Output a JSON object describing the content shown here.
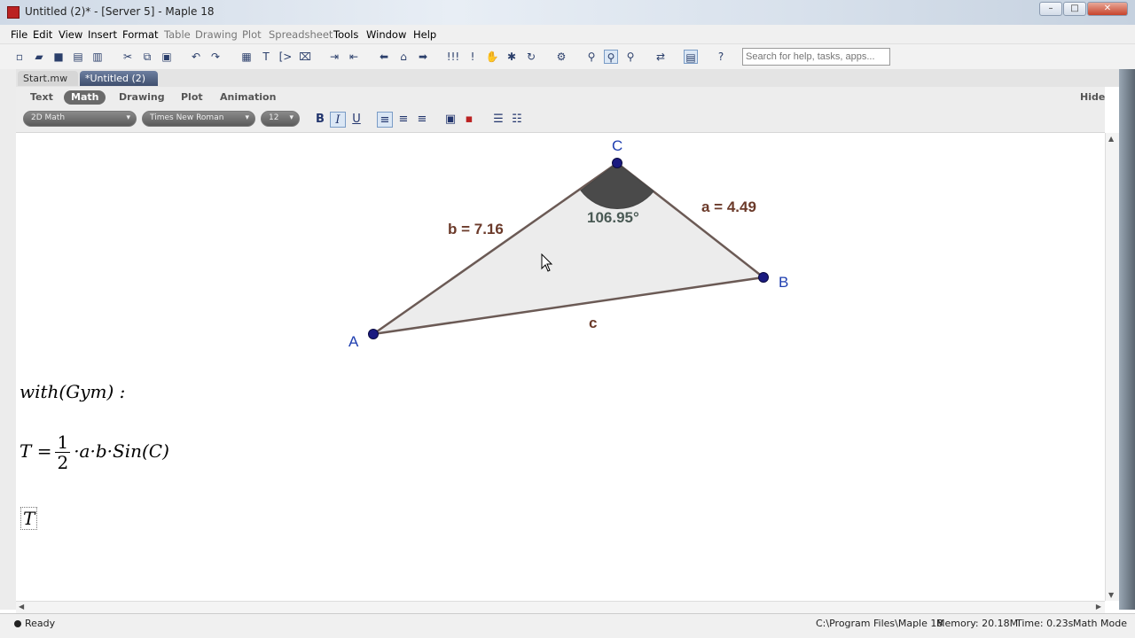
{
  "window": {
    "title": "Untitled (2)* - [Server 5] - Maple 18",
    "controls": [
      "–",
      "□",
      "✕"
    ]
  },
  "menu": [
    "File",
    "Edit",
    "View",
    "Insert",
    "Format",
    "Table",
    "Drawing",
    "Plot",
    "Spreadsheet",
    "Tools",
    "Window",
    "Help"
  ],
  "search": {
    "placeholder": "Search for help, tasks, apps..."
  },
  "doc_tabs": [
    {
      "label": "Start.mw"
    },
    {
      "label": "*Untitled (2)",
      "close": "✕"
    }
  ],
  "context_bar": {
    "tabs": [
      "Text",
      "Math",
      "Drawing",
      "Plot",
      "Animation"
    ],
    "selected_tab": "Math",
    "hide_label": "Hide",
    "style_select": "2D Math",
    "font_select": "Times New Roman",
    "size_select": "12",
    "bold_label": "B",
    "italic_label": "I",
    "underline_label": "U"
  },
  "geometry": {
    "points": [
      {
        "label": "A",
        "color": "#1f3fb0"
      },
      {
        "label": "B",
        "color": "#1f3fb0"
      },
      {
        "label": "C",
        "color": "#1f3fb0"
      }
    ],
    "side_labels": {
      "a": "a = 4.49",
      "b": "b = 7.16",
      "c": "c"
    },
    "angle_label": "106.95°",
    "label_color": "#6b3a2a",
    "triangle_fill": "#ececec",
    "angle_fill": "#4a4a4a"
  },
  "math": {
    "line1": "with(Gym) :",
    "line2_lhs": "T =",
    "line2_num": "1",
    "line2_den": "2",
    "line2_rest": "·a·b·Sin(C)",
    "line3": "T"
  },
  "status": {
    "ready": "Ready",
    "path": "C:\\Program Files\\Maple 18",
    "memory": "Memory: 20.18M",
    "time": "Time: 0.23s",
    "mode": "Math Mode"
  }
}
